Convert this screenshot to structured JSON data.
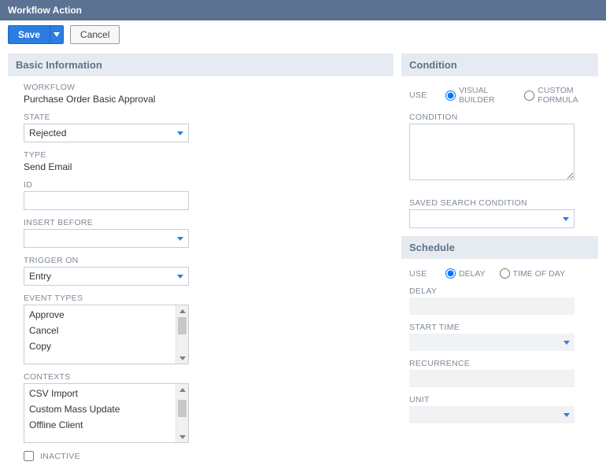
{
  "title": "Workflow Action",
  "toolbar": {
    "save": "Save",
    "cancel": "Cancel"
  },
  "basic": {
    "section": "Basic Information",
    "workflow_label": "WORKFLOW",
    "workflow_value": "Purchase Order Basic Approval",
    "state_label": "STATE",
    "state_value": "Rejected",
    "type_label": "TYPE",
    "type_value": "Send Email",
    "id_label": "ID",
    "id_value": "",
    "insert_before_label": "INSERT BEFORE",
    "insert_before_value": "",
    "trigger_on_label": "TRIGGER ON",
    "trigger_on_value": "Entry",
    "event_types_label": "EVENT TYPES",
    "event_types_items": [
      "Approve",
      "Cancel",
      "Copy"
    ],
    "contexts_label": "CONTEXTS",
    "contexts_items": [
      "CSV Import",
      "Custom Mass Update",
      "Offline Client"
    ],
    "inactive_label": "INACTIVE",
    "inactive_checked": false
  },
  "condition": {
    "section": "Condition",
    "use_label": "USE",
    "opt_visual": "VISUAL BUILDER",
    "opt_formula": "CUSTOM FORMULA",
    "selected": "visual",
    "condition_label": "CONDITION",
    "condition_value": "",
    "saved_search_label": "SAVED SEARCH CONDITION",
    "saved_search_value": ""
  },
  "schedule": {
    "section": "Schedule",
    "use_label": "USE",
    "opt_delay": "DELAY",
    "opt_time": "TIME OF DAY",
    "selected": "delay",
    "delay_label": "DELAY",
    "start_time_label": "START TIME",
    "recurrence_label": "RECURRENCE",
    "unit_label": "UNIT"
  }
}
